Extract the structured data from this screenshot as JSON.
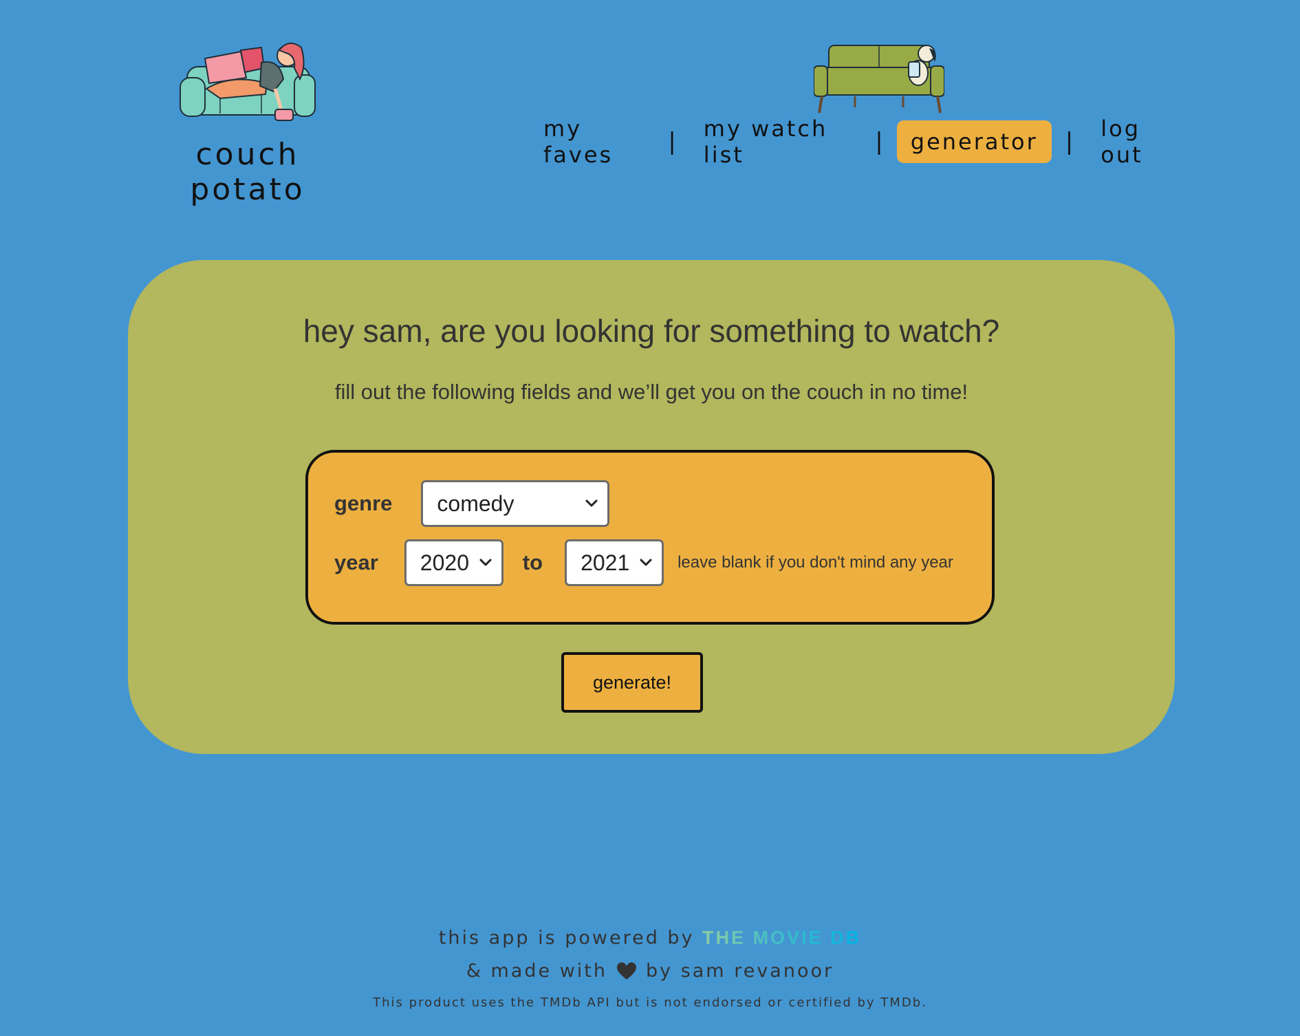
{
  "brand": {
    "name": "couch potato",
    "illustration": "person-lounging-on-couch"
  },
  "nav": {
    "illustration": "dog-on-green-couch",
    "items": [
      {
        "label": "my faves",
        "active": false
      },
      {
        "label": "my watch list",
        "active": false
      },
      {
        "label": "generator",
        "active": true
      },
      {
        "label": "log out",
        "active": false
      }
    ],
    "separator": "|"
  },
  "main": {
    "title": "hey sam, are you looking for something to watch?",
    "subtitle": "fill out the following fields and we’ll get you on the couch in no time!",
    "form": {
      "genre_label": "genre",
      "genre_value": "comedy",
      "year_label": "year",
      "year_from": "2020",
      "to_label": "to",
      "year_to": "2021",
      "year_hint": "leave blank if you don't mind any year"
    },
    "generate_label": "generate!"
  },
  "footer": {
    "powered_prefix": "this app is powered by",
    "tmdb_logo": "THE MOVIE DB",
    "made_with_prefix": "& made with",
    "heart_icon": "heart-icon",
    "made_with_suffix": "by sam revanoor",
    "disclaimer": "This product uses the TMDb API but is not endorsed or certified by TMDb."
  },
  "colors": {
    "background": "#4496d1",
    "card": "#b3b75d",
    "accent": "#edb040",
    "text": "#333333"
  }
}
